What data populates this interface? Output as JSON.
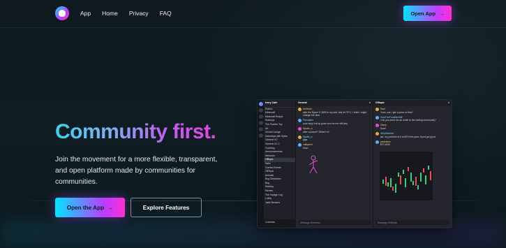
{
  "nav": {
    "links": [
      "App",
      "Home",
      "Privacy",
      "FAQ"
    ],
    "cta_label": "Open App",
    "cta_arrow": "→"
  },
  "hero": {
    "title": "Community first.",
    "description": "Join the movement for a more flexible, transparent, and open platform made by communities for communities.",
    "primary_label": "Open the App",
    "primary_arrow": "→",
    "secondary_label": "Explore Features"
  },
  "preview": {
    "server_name": "Ivory Cafe",
    "channels": [
      "Roblox",
      "Minecraft",
      "Minecraft Redpix",
      "Starboys",
      "The Powder Toy",
      "Art",
      "Vrchat Lounge",
      "Saturdays with Spike",
      "General VC",
      "General VC 2",
      "Counting",
      "Announcements",
      "Welcome",
      "Offtopic",
      "Nsfw",
      "Current Events",
      "OffTopic",
      "Animals",
      "Bog Delicacies",
      "Bog",
      "Raiding",
      "Memes",
      "The Voyage Log",
      "Lobby",
      "Jade Streams"
    ],
    "active_channel": "Offtopic",
    "user_name": "Codestar",
    "left_pane": {
      "title": "General",
      "messages": [
        {
          "name": "ImOnion",
          "text": "with the Ryzen 5 3600 in my test, this hit 75°C, I think I might change the fans"
        },
        {
          "name": "Pancakes",
          "text": "your reply but by gone now for me still why"
        },
        {
          "name": "Spider_a",
          "text": "after a planet? What it is? "
        },
        {
          "name": "Spider_a",
          "text": "gigs"
        },
        {
          "name": "cattyarch",
          "text": "lmao"
        }
      ],
      "input_placeholder": "Message #General"
    },
    "right_pane": {
      "title": "Offtopic",
      "messages": [
        {
          "name": "Saul",
          "text": "Yeah, can I get a piece of that?"
        },
        {
          "name": "HowTheFoodBerStiff",
          "text": "Can you send me an invite to the batting community?"
        },
        {
          "name": "Ginny",
          "text": "Sure!"
        },
        {
          "name": "StripWatcher",
          "text": "jist, my portfolio at it at 50% this year, it just got good"
        },
        {
          "name": "pancakes",
          "text": "BTCUSD"
        }
      ],
      "input_placeholder": "Message #Offtopic"
    }
  },
  "colors": {
    "accent_cyan": "#00e5ff",
    "accent_purple": "#b83dff",
    "accent_pink": "#ff2fd0",
    "background": "#0e1a1f"
  }
}
